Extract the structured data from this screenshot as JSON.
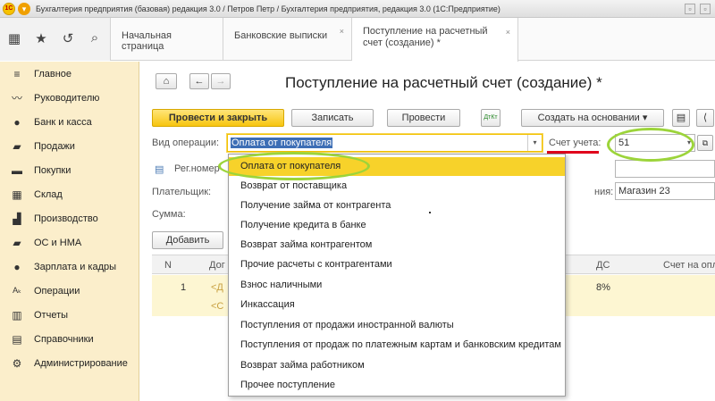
{
  "window": {
    "title": "Бухгалтерия предприятия (базовая) редакция 3.0 / Петров Петр / Бухгалтерия предприятия, редакция 3.0  (1С:Предприятие)",
    "logo_text": "1С"
  },
  "nav_icons": [
    "grid-icon",
    "star-icon",
    "history-icon",
    "search-icon"
  ],
  "tabs": [
    {
      "label": "Начальная страница"
    },
    {
      "label": "Банковские выписки",
      "close": "×"
    },
    {
      "label_line1": "Поступление на расчетный",
      "label_line2": "счет (создание) *",
      "close": "×"
    }
  ],
  "sidebar": {
    "items": [
      {
        "label": "Главное",
        "icon": "menu-icon",
        "glyph": "≡"
      },
      {
        "label": "Руководителю",
        "icon": "trend-icon",
        "glyph": "〰"
      },
      {
        "label": "Банк и касса",
        "icon": "bank-icon",
        "glyph": "●"
      },
      {
        "label": "Продажи",
        "icon": "sales-icon",
        "glyph": "▰"
      },
      {
        "label": "Покупки",
        "icon": "cart-icon",
        "glyph": "▬"
      },
      {
        "label": "Склад",
        "icon": "warehouse-icon",
        "glyph": "▦"
      },
      {
        "label": "Производство",
        "icon": "factory-icon",
        "glyph": "▟"
      },
      {
        "label": "ОС и НМА",
        "icon": "truck-icon",
        "glyph": "▰"
      },
      {
        "label": "Зарплата и кадры",
        "icon": "person-icon",
        "glyph": "●"
      },
      {
        "label": "Операции",
        "icon": "operations-icon",
        "glyph": "Aₖ"
      },
      {
        "label": "Отчеты",
        "icon": "reports-icon",
        "glyph": "▥"
      },
      {
        "label": "Справочники",
        "icon": "book-icon",
        "glyph": "▤"
      },
      {
        "label": "Администрирование",
        "icon": "gear-icon",
        "glyph": "⚙"
      }
    ]
  },
  "form": {
    "title": "Поступление на расчетный счет (создание) *",
    "home_glyph": "⌂",
    "back_glyph": "←",
    "forward_glyph": "→",
    "buttons": {
      "post_close": "Провести и закрыть",
      "save": "Записать",
      "post": "Провести",
      "create_based": "Создать на основании",
      "create_based_arrow": "▾",
      "dtkt": "ДтКт"
    },
    "op_type_label": "Вид операции:",
    "op_type_value": "Оплата от покупателя",
    "account_label": "Счет учета:",
    "account_value": "51",
    "reg_label": "Рег.номер",
    "payer_label": "Плательщик:",
    "sum_label": "Сумма:",
    "contract_label_tail": "ния:",
    "contract_value": "Магазин 23",
    "add_button": "Добавить"
  },
  "table": {
    "columns": [
      "N",
      "Дог",
      "ДС",
      "Счет на опл"
    ],
    "row": {
      "n": "1",
      "contract_part": "<Д",
      "contract_part2": "<С",
      "vat": "8%"
    }
  },
  "dropdown": {
    "items": [
      "Оплата от покупателя",
      "Возврат от поставщика",
      "Получение займа от контрагента",
      "Получение кредита в банке",
      "Возврат займа контрагентом",
      "Прочие расчеты с контрагентами",
      "Взнос наличными",
      "Инкассация",
      "Поступления от продажи иностранной валюты",
      "Поступления от продаж по платежным картам и банковским кредитам",
      "Возврат займа работником",
      "Прочее поступление"
    ],
    "selected_index": 0
  },
  "colors": {
    "accent_yellow": "#f7c50f",
    "sidebar_bg": "#fbeecb",
    "selection_blue": "#3d6eb5",
    "annotation_green": "#9cd43a",
    "annotation_red": "#e0001b"
  }
}
